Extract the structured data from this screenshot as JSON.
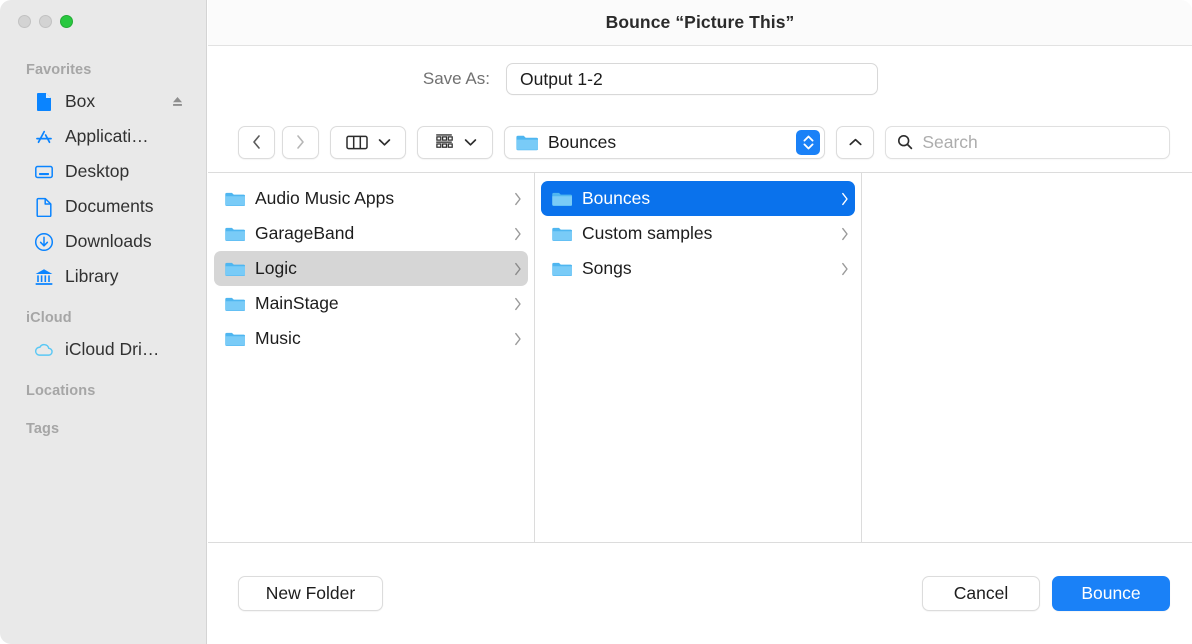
{
  "window": {
    "title": "Bounce “Picture This”",
    "traffic_lights": [
      "close",
      "minimize",
      "zoom"
    ]
  },
  "sidebar": {
    "sections": [
      {
        "header": "Favorites",
        "items": [
          {
            "label": "Box",
            "icon": "document-filled-icon",
            "eject": true
          },
          {
            "label": "Applicati…",
            "icon": "app-store-icon",
            "eject": false
          },
          {
            "label": "Desktop",
            "icon": "desktop-icon",
            "eject": false
          },
          {
            "label": "Documents",
            "icon": "documents-icon",
            "eject": false
          },
          {
            "label": "Downloads",
            "icon": "downloads-icon",
            "eject": false
          },
          {
            "label": "Library",
            "icon": "library-icon",
            "eject": false
          }
        ]
      },
      {
        "header": "iCloud",
        "items": [
          {
            "label": "iCloud Dri…",
            "icon": "icloud-icon",
            "eject": false
          }
        ]
      },
      {
        "header": "Locations",
        "items": []
      },
      {
        "header": "Tags",
        "items": []
      }
    ]
  },
  "save_as": {
    "label": "Save As:",
    "value": "Output 1-2",
    "placeholder": "Name"
  },
  "toolbar": {
    "back_icon": "chevron-left-icon",
    "forward_icon": "chevron-right-icon",
    "view_icon": "column-view-icon",
    "view_chevron": "chevron-down-icon",
    "group_icon": "group-by-icon",
    "group_chevron": "chevron-down-icon",
    "path_label": "Bounces",
    "path_icon": "folder-icon",
    "path_stepper_icon": "up-down-chevrons-icon",
    "up_icon": "chevron-up-icon",
    "search_icon": "search-icon",
    "search_placeholder": "Search",
    "search_value": ""
  },
  "browser": {
    "columns": [
      {
        "name": "column-1",
        "items": [
          {
            "label": "Audio Music Apps",
            "selected": false,
            "has_children": true
          },
          {
            "label": "GarageBand",
            "selected": false,
            "has_children": true
          },
          {
            "label": "Logic",
            "selected": "inactive",
            "has_children": true
          },
          {
            "label": "MainStage",
            "selected": false,
            "has_children": true
          },
          {
            "label": "Music",
            "selected": false,
            "has_children": true
          }
        ]
      },
      {
        "name": "column-2",
        "items": [
          {
            "label": "Bounces",
            "selected": "active",
            "has_children": true
          },
          {
            "label": "Custom samples",
            "selected": false,
            "has_children": true
          },
          {
            "label": "Songs",
            "selected": false,
            "has_children": true
          }
        ]
      },
      {
        "name": "column-3",
        "items": []
      }
    ]
  },
  "footer": {
    "new_folder_label": "New Folder",
    "cancel_label": "Cancel",
    "confirm_label": "Bounce"
  },
  "colors": {
    "accent_blue": "#1a81f7",
    "selection_blue": "#0a72ec",
    "inactive_selection": "#d6d6d6",
    "folder_blue": "#5ec2f5",
    "sidebar_bg": "#e9e9e9",
    "green_light": "#28c83f"
  }
}
